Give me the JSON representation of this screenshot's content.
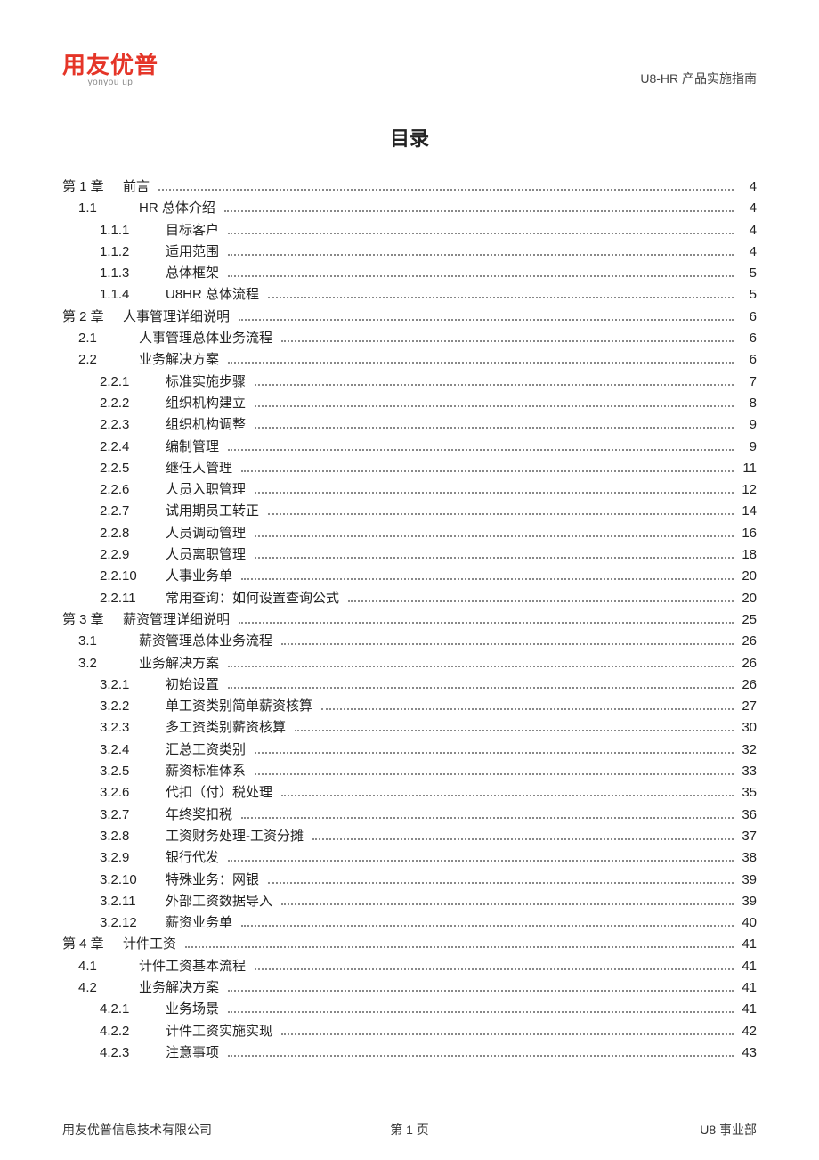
{
  "header": {
    "logo_main": "用友优普",
    "logo_sub": "yonyou up",
    "product_name": "U8-HR 产品实施指南"
  },
  "title": "目录",
  "toc": [
    {
      "lvl": 1,
      "num": "第 1 章",
      "title": "前言",
      "page": "4"
    },
    {
      "lvl": 2,
      "num": "1.1",
      "title": "HR 总体介绍",
      "page": "4"
    },
    {
      "lvl": 3,
      "num": "1.1.1",
      "title": "目标客户",
      "page": "4"
    },
    {
      "lvl": 3,
      "num": "1.1.2",
      "title": "适用范围",
      "page": "4"
    },
    {
      "lvl": 3,
      "num": "1.1.3",
      "title": "总体框架",
      "page": "5"
    },
    {
      "lvl": 3,
      "num": "1.1.4",
      "title": "U8HR 总体流程",
      "page": "5"
    },
    {
      "lvl": 1,
      "num": "第 2 章",
      "title": "人事管理详细说明",
      "page": "6"
    },
    {
      "lvl": 2,
      "num": "2.1",
      "title": "人事管理总体业务流程",
      "page": "6"
    },
    {
      "lvl": 2,
      "num": "2.2",
      "title": "业务解决方案",
      "page": "6"
    },
    {
      "lvl": 3,
      "num": "2.2.1",
      "title": "标准实施步骤",
      "page": "7"
    },
    {
      "lvl": 3,
      "num": "2.2.2",
      "title": "组织机构建立",
      "page": "8"
    },
    {
      "lvl": 3,
      "num": "2.2.3",
      "title": "组织机构调整",
      "page": "9"
    },
    {
      "lvl": 3,
      "num": "2.2.4",
      "title": "编制管理",
      "page": "9"
    },
    {
      "lvl": 3,
      "num": "2.2.5",
      "title": "继任人管理",
      "page": "11"
    },
    {
      "lvl": 3,
      "num": "2.2.6",
      "title": "人员入职管理",
      "page": "12"
    },
    {
      "lvl": 3,
      "num": "2.2.7",
      "title": "试用期员工转正",
      "page": "14"
    },
    {
      "lvl": 3,
      "num": "2.2.8",
      "title": "人员调动管理",
      "page": "16"
    },
    {
      "lvl": 3,
      "num": "2.2.9",
      "title": "人员离职管理",
      "page": "18"
    },
    {
      "lvl": 3,
      "num": "2.2.10",
      "title": "人事业务单",
      "page": "20"
    },
    {
      "lvl": 3,
      "num": "2.2.11",
      "title": "常用查询：如何设置查询公式",
      "page": "20"
    },
    {
      "lvl": 1,
      "num": "第 3 章",
      "title": "薪资管理详细说明",
      "page": "25"
    },
    {
      "lvl": 2,
      "num": "3.1",
      "title": "薪资管理总体业务流程",
      "page": "26"
    },
    {
      "lvl": 2,
      "num": "3.2",
      "title": "业务解决方案",
      "page": "26"
    },
    {
      "lvl": 3,
      "num": "3.2.1",
      "title": "初始设置",
      "page": "26"
    },
    {
      "lvl": 3,
      "num": "3.2.2",
      "title": "单工资类别简单薪资核算",
      "page": "27"
    },
    {
      "lvl": 3,
      "num": "3.2.3",
      "title": "多工资类别薪资核算",
      "page": "30"
    },
    {
      "lvl": 3,
      "num": "3.2.4",
      "title": "汇总工资类别",
      "page": "32"
    },
    {
      "lvl": 3,
      "num": "3.2.5",
      "title": "薪资标准体系",
      "page": "33"
    },
    {
      "lvl": 3,
      "num": "3.2.6",
      "title": "代扣（付）税处理",
      "page": "35"
    },
    {
      "lvl": 3,
      "num": "3.2.7",
      "title": "年终奖扣税",
      "page": "36"
    },
    {
      "lvl": 3,
      "num": "3.2.8",
      "title": "工资财务处理-工资分摊",
      "page": "37"
    },
    {
      "lvl": 3,
      "num": "3.2.9",
      "title": "银行代发",
      "page": "38"
    },
    {
      "lvl": 3,
      "num": "3.2.10",
      "title": "特殊业务：网银",
      "page": "39"
    },
    {
      "lvl": 3,
      "num": "3.2.11",
      "title": "外部工资数据导入",
      "page": "39"
    },
    {
      "lvl": 3,
      "num": "3.2.12",
      "title": "薪资业务单",
      "page": "40"
    },
    {
      "lvl": 1,
      "num": "第 4 章",
      "title": "计件工资",
      "page": "41"
    },
    {
      "lvl": 2,
      "num": "4.1",
      "title": "计件工资基本流程",
      "page": "41"
    },
    {
      "lvl": 2,
      "num": "4.2",
      "title": "业务解决方案",
      "page": "41"
    },
    {
      "lvl": 3,
      "num": "4.2.1",
      "title": "业务场景",
      "page": "41"
    },
    {
      "lvl": 3,
      "num": "4.2.2",
      "title": "计件工资实施实现",
      "page": "42"
    },
    {
      "lvl": 3,
      "num": "4.2.3",
      "title": "注意事项",
      "page": "43"
    }
  ],
  "footer": {
    "left": "用友优普信息技术有限公司",
    "mid": "第 1 页",
    "right": "U8 事业部"
  }
}
